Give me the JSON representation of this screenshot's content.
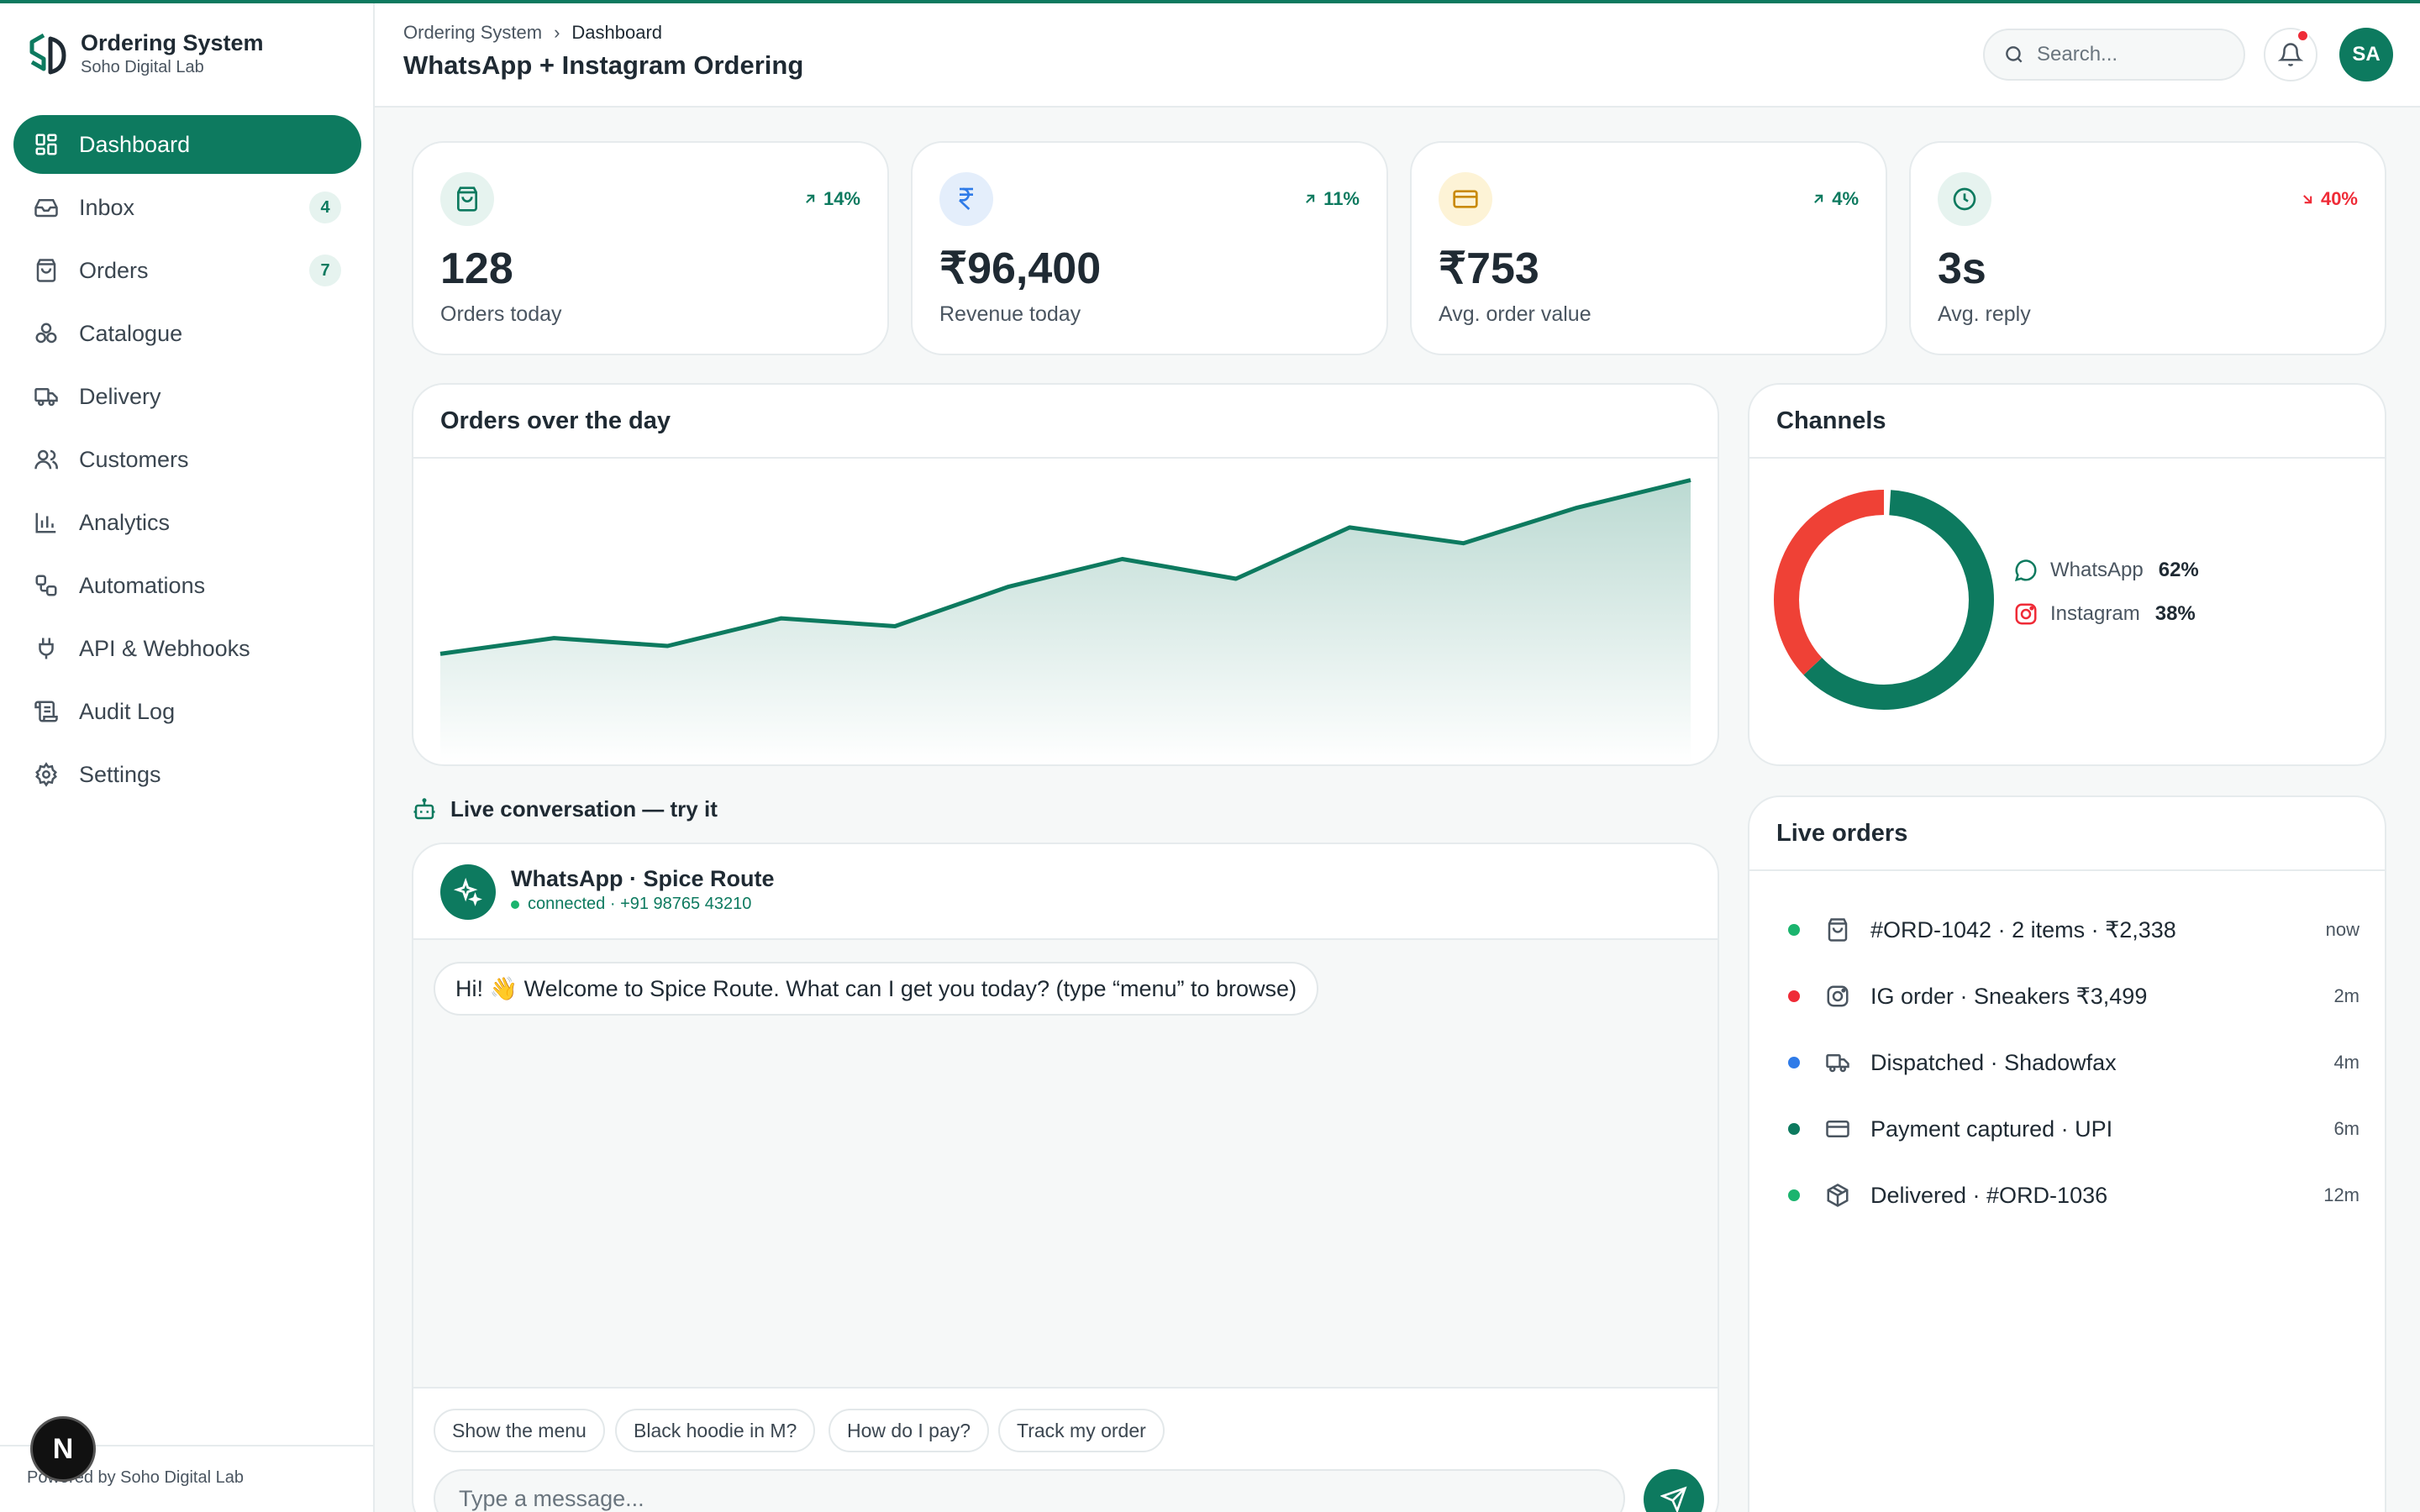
{
  "app": {
    "title": "Ordering System",
    "org": "Soho Digital Lab",
    "footer": "Powered by Soho Digital Lab",
    "footer_badge": "N"
  },
  "nav": [
    {
      "label": "Dashboard",
      "icon": "dashboard-icon",
      "active": true
    },
    {
      "label": "Inbox",
      "icon": "inbox-icon",
      "badge": "4"
    },
    {
      "label": "Orders",
      "icon": "shopping-bag-icon",
      "badge": "7"
    },
    {
      "label": "Catalogue",
      "icon": "boxes-icon"
    },
    {
      "label": "Delivery",
      "icon": "truck-icon"
    },
    {
      "label": "Customers",
      "icon": "users-icon"
    },
    {
      "label": "Analytics",
      "icon": "bar-chart-icon"
    },
    {
      "label": "Automations",
      "icon": "workflow-icon"
    },
    {
      "label": "API & Webhooks",
      "icon": "plug-icon"
    },
    {
      "label": "Audit Log",
      "icon": "scroll-icon"
    },
    {
      "label": "Settings",
      "icon": "gear-icon"
    }
  ],
  "header": {
    "breadcrumb": [
      "Ordering System",
      "Dashboard"
    ],
    "title": "WhatsApp + Instagram Ordering",
    "search_placeholder": "Search...",
    "avatar_initials": "SA"
  },
  "kpis": [
    {
      "value": "128",
      "label": "Orders today",
      "trend": "14%",
      "direction": "up",
      "icon": "shopping-bag-icon"
    },
    {
      "value": "₹96,400",
      "label": "Revenue today",
      "trend": "11%",
      "direction": "up",
      "icon": "rupee-icon"
    },
    {
      "value": "₹753",
      "label": "Avg. order value",
      "trend": "4%",
      "direction": "up",
      "icon": "credit-card-icon"
    },
    {
      "value": "3s",
      "label": "Avg. reply",
      "trend": "40%",
      "direction": "down",
      "icon": "clock-icon"
    }
  ],
  "chart_data": [
    {
      "type": "area",
      "title": "Orders over the day",
      "values": [
        6,
        10,
        8,
        15,
        13,
        23,
        30,
        25,
        38,
        34,
        43,
        50
      ],
      "ylim": [
        -22,
        55
      ],
      "grid": false,
      "color": "#0d7a5f"
    },
    {
      "type": "pie",
      "title": "Channels",
      "categories": [
        "WhatsApp",
        "Instagram"
      ],
      "values": [
        62,
        38
      ],
      "labels": [
        "62%",
        "38%"
      ],
      "colors": [
        "#0d7a5f",
        "#ef4136"
      ]
    }
  ],
  "live_conversation": {
    "title": "Live conversation — try it",
    "contact": "WhatsApp · Spice Route",
    "status": "connected · +91 98765 43210",
    "messages": [
      "Hi! 👋 Welcome to Spice Route. What can I get you today? (type “menu” to browse)"
    ],
    "quick_replies": [
      "Show the menu",
      "Black hoodie in M?",
      "How do I pay?",
      "Track my order"
    ],
    "input_placeholder": "Type a message..."
  },
  "live_orders": {
    "title": "Live orders",
    "items": [
      {
        "text": "#ORD-1042 · 2 items · ₹2,338",
        "time": "now",
        "dot": "#1bb46e",
        "icon": "shopping-bag-icon"
      },
      {
        "text": "IG order · Sneakers ₹3,499",
        "time": "2m",
        "dot": "#ef2b37",
        "icon": "instagram-icon"
      },
      {
        "text": "Dispatched · Shadowfax",
        "time": "4m",
        "dot": "#2f7be8",
        "icon": "truck-icon"
      },
      {
        "text": "Payment captured · UPI",
        "time": "6m",
        "dot": "#0d7a5f",
        "icon": "credit-card-icon"
      },
      {
        "text": "Delivered · #ORD-1036",
        "time": "12m",
        "dot": "#1bb46e",
        "icon": "package-icon"
      }
    ]
  },
  "colors": {
    "brand": "#0d7a5f",
    "danger": "#ef2b37",
    "accent_red": "#ef4136"
  }
}
